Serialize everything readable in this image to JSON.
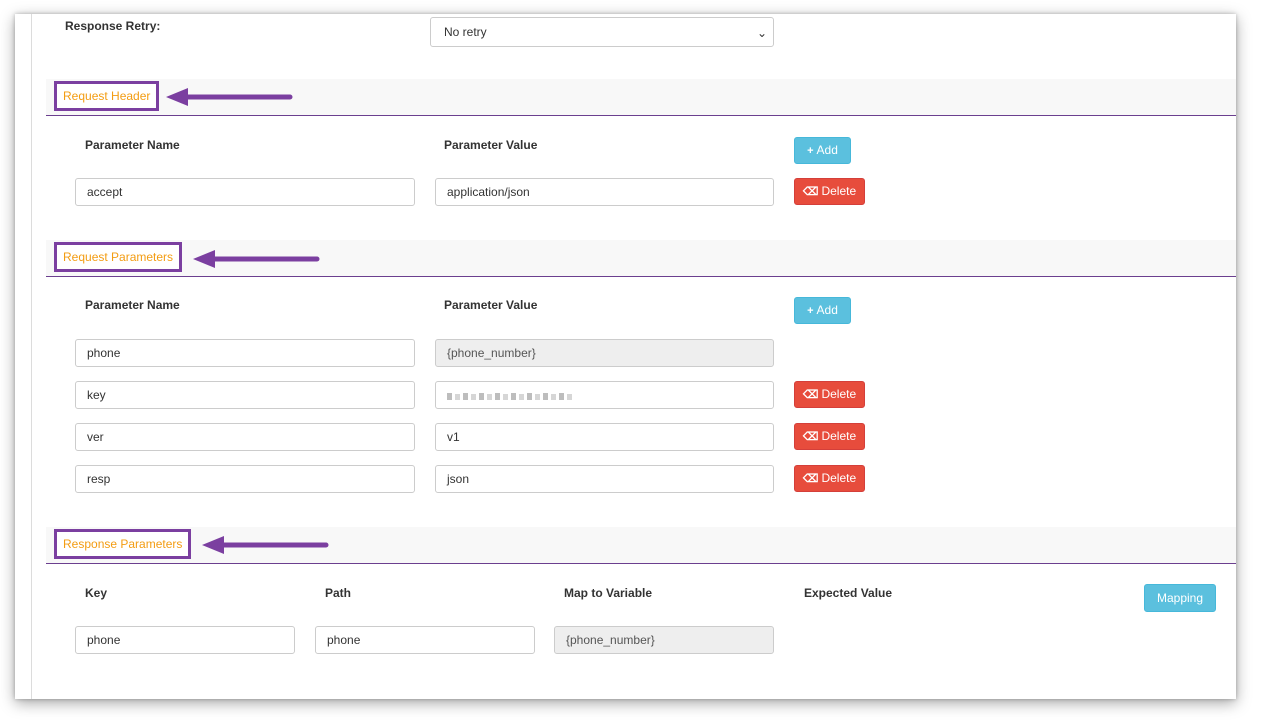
{
  "response_retry": {
    "label": "Response Retry:",
    "selected": "No retry"
  },
  "request_header": {
    "title": "Request Header",
    "col_name": "Parameter Name",
    "col_value": "Parameter Value",
    "add_label": "Add",
    "rows": [
      {
        "name": "accept",
        "value": "application/json",
        "delete_label": "Delete"
      }
    ]
  },
  "request_parameters": {
    "title": "Request Parameters",
    "col_name": "Parameter Name",
    "col_value": "Parameter Value",
    "add_label": "Add",
    "rows": [
      {
        "name": "phone",
        "value": "{phone_number}"
      },
      {
        "name": "key",
        "value": "",
        "delete_label": "Delete"
      },
      {
        "name": "ver",
        "value": "v1",
        "delete_label": "Delete"
      },
      {
        "name": "resp",
        "value": "json",
        "delete_label": "Delete"
      }
    ]
  },
  "response_parameters": {
    "title": "Response Parameters",
    "col_key": "Key",
    "col_path": "Path",
    "col_map": "Map to Variable",
    "col_expected": "Expected Value",
    "mapping_label": "Mapping",
    "rows": [
      {
        "key": "phone",
        "path": "phone",
        "map": "{phone_number}"
      }
    ]
  },
  "colors": {
    "accent_orange": "#f39c12",
    "highlight_purple": "#7b3fa0",
    "add_blue": "#5bc0de",
    "delete_red": "#e74c3c"
  }
}
